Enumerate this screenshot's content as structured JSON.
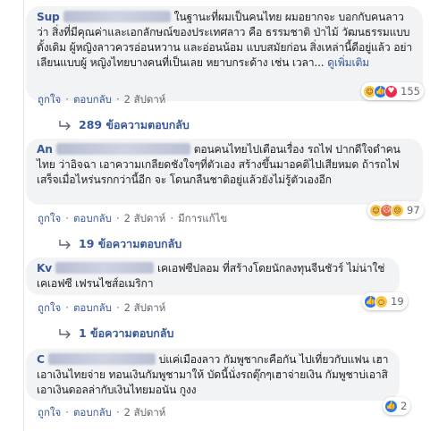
{
  "comments": [
    {
      "author": "Sup",
      "text": "ในฐานะที่ผมเป็นคนไทย ผมอยากจะ บอกกับคนลาวว่า สิ่งที่มีคุณค่าและเอกลักษณ์ของประเทศลาว คือ ธรรมชาติ ป่าไม้ วัฒนธรรมแบบดั้งเดิม ผู้หญิงลาวควรอ่อนหวาน และอ่อนน้อม แบบสมัยก่อน สิ่งเหล่านี้ดีอยู่แล้ว อย่าเลียนแบบผู้ หญิงไทยบางคนที่เป็นเลย หยาบกระด้าง เช่น เวลา...",
      "see_more": "ดูเพิ่มเติม",
      "reaction_count": "155",
      "reaction_icons": [
        "haha-icon",
        "like-icon",
        "love-icon"
      ],
      "like": "ถูกใจ",
      "reply": "ตอบกลับ",
      "time": "2 สัปดาห์",
      "edited": "",
      "replies_label": "289 ข้อความตอบกลับ"
    },
    {
      "author": "An",
      "text": "ตอนคนไทยไปเตือนเรื่อง รถไฟ ปากดีใจดำคนไทย ว่าอิจฉา เอาความเกลียดชังใจๆที่ตัวเอง สร้างขึ้นมาอคติไปเสียหมด ถ้ารถไฟเสร็จเมื่อไหร่นรกกว่านี้อีก จะ โดนกลืนชาติอยู่แล้วยังไม่รู้ตัวเองอีก",
      "see_more": "",
      "reaction_count": "97",
      "reaction_icons": [
        "haha-icon",
        "angry-icon",
        "sad-icon"
      ],
      "like": "ถูกใจ",
      "reply": "ตอบกลับ",
      "time": "2 สัปดาห์",
      "edited": "มีการแก้ไข",
      "replies_label": "19 ข้อความตอบกลับ"
    },
    {
      "author": "Kv",
      "text": "เคเอฟซีปลอม ที่สร้างโดยนักลงทุนจีนชัวร์ ไม่น่าใช่เคเอฟซี เฟรนไชส์อเมริกา",
      "see_more": "",
      "reaction_count": "19",
      "reaction_icons": [
        "like-icon",
        "wow-icon"
      ],
      "like": "ถูกใจ",
      "reply": "ตอบกลับ",
      "time": "2 สัปดาห์",
      "edited": "",
      "replies_label": "1 ข้อความตอบกลับ"
    },
    {
      "author": "C",
      "text": "บ่แค่เมืองลาว กัมพูชากะคือกัน ไปเที่ยวกับแฟน เฮา เอาเงินไทยจ่าย ทอนเงินกัมพูชามาให้ บัดนี้นั่งรถตุ๊กๆเฮาจ่ายเงิน กัมพูชาบ่เอาสิเอาเงินดอลล่ากับเงินไทยมอนัน กูงง",
      "see_more": "",
      "reaction_count": "2",
      "reaction_icons": [
        "like-icon"
      ],
      "like": "ถูกใจ",
      "reply": "ตอบกลับ",
      "time": "2 สัปดาห์",
      "edited": "",
      "replies_label": ""
    }
  ]
}
